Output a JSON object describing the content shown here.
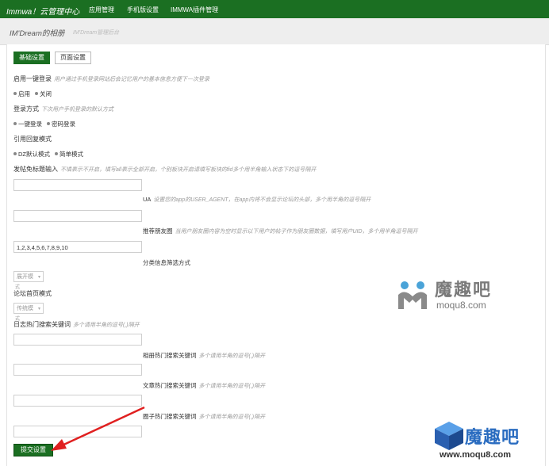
{
  "topbar": {
    "brand": "Immwa！云管理中心",
    "nav": [
      "应用管理",
      "手机版设置",
      "IMMWA插件管理"
    ]
  },
  "page": {
    "title": "IM'Dream的相册",
    "subtitle": "IM'Dream管理后台"
  },
  "tabs": [
    "基础设置",
    "页面设置"
  ],
  "sections": {
    "login": {
      "label": "启用一键登录",
      "hint": "用户通过手机登录网站后会记忆用户的基本信息方便下一次登录",
      "options": [
        "启用",
        "关闭"
      ]
    },
    "login_mode": {
      "label": "登录方式",
      "hint": "下次用户手机登录的默认方式",
      "options": [
        "一键登录",
        "密码登录"
      ]
    },
    "reply_mode": {
      "label": "引用回复模式",
      "options": [
        "DZ默认模式",
        "简单模式"
      ]
    },
    "title_input": {
      "label": "发帖免标题输入",
      "hint": "不填表示不开启，填写all表示全部开启，个别板块开启请填写板块的fid多个用半角输入状态下的逗号隔开",
      "value": ""
    },
    "ua": {
      "label": "UA",
      "hint": "设置您的app的USER_AGENT，在app内将不会显示论坛的头部，多个用半角的逗号隔开",
      "value": ""
    },
    "friends": {
      "label": "推荐朋友圈",
      "hint": "当用户朋友圈内容为空时显示以下用户的帖子作为朋友圈数据，填写用户UID，多个用半角逗号隔开",
      "value": "1,2,3,4,5,6,7,8,9,10"
    },
    "category": {
      "label": "分类信息筛选方式",
      "select": "展开模",
      "select_tail": "式"
    },
    "forum_home": {
      "label": "论坛首页模式",
      "select": "传统模",
      "select_tail": "式"
    },
    "log_keywords": {
      "label": "日志热门搜索关键词",
      "hint": "多个请用半角的逗号(,)隔开",
      "value": ""
    },
    "album_keywords": {
      "label": "相册热门搜索关键词",
      "hint": "多个请用半角的逗号(,)隔开",
      "value": ""
    },
    "article_keywords": {
      "label": "文章热门搜索关键词",
      "hint": "多个请用半角的逗号(,)隔开",
      "value": ""
    },
    "circle_keywords": {
      "label": "圈子热门搜索关键词",
      "hint": "多个请用半角的逗号(,)隔开",
      "value": ""
    }
  },
  "submit_label": "提交设置",
  "watermark1": {
    "name": "魔趣吧",
    "url": "moqu8.com"
  },
  "watermark2": {
    "name": "魔趣吧",
    "url": "www.moqu8.com"
  }
}
